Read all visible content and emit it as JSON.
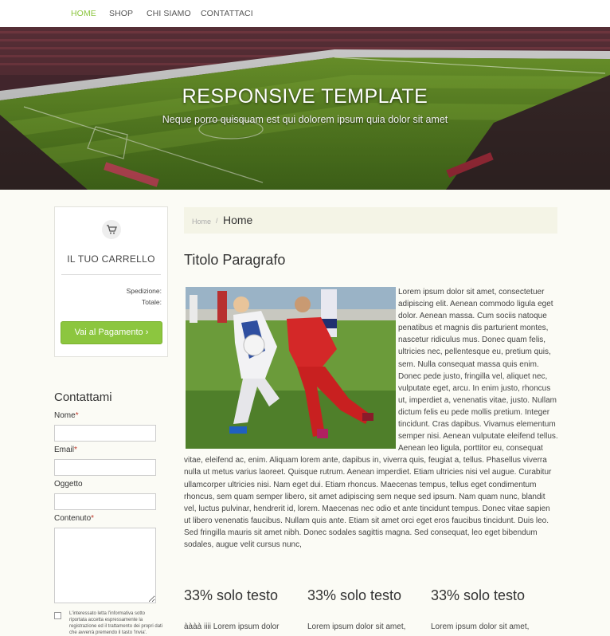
{
  "nav": {
    "items": [
      {
        "label": "HOME",
        "active": true
      },
      {
        "label": "SHOP",
        "active": false
      },
      {
        "label": "CHI SIAMO",
        "active": false
      },
      {
        "label": "CONTATTACI",
        "active": false
      }
    ]
  },
  "hero": {
    "title": "RESPONSIVE TEMPLATE",
    "subtitle": "Neque porro quisquam est qui dolorem ipsum quia dolor sit amet",
    "image": "football-stadium"
  },
  "cart": {
    "icon": "cart-icon",
    "title": "IL TUO CARRELLO",
    "shipping_label": "Spedizione:",
    "total_label": "Totale:",
    "pay_button": "Vai al Pagamento ›"
  },
  "contact": {
    "heading": "Contattami",
    "fields": {
      "name": {
        "label": "Nome",
        "required_mark": "*",
        "value": ""
      },
      "email": {
        "label": "Email",
        "required_mark": "*",
        "value": ""
      },
      "subject": {
        "label": "Oggetto",
        "value": ""
      },
      "content": {
        "label": "Contenuto",
        "required_mark": "*",
        "value": ""
      }
    },
    "privacy_text": "L'interessato letta l'informativa sotto riportata accetta espressamente la registrazione ed il trattamento dei propri dati che avverrà premendo il tasto 'Invia'."
  },
  "breadcrumb": {
    "home": "Home",
    "separator": "/",
    "current": "Home"
  },
  "main": {
    "title": "Titolo Paragrafo",
    "image": "football-players-photo",
    "body": "Lorem ipsum dolor sit amet, consectetuer adipiscing elit. Aenean commodo ligula eget dolor. Aenean massa. Cum sociis natoque penatibus et magnis dis parturient montes, nascetur ridiculus mus. Donec quam felis, ultricies nec, pellentesque eu, pretium quis, sem. Nulla consequat massa quis enim. Donec pede justo, fringilla vel, aliquet nec, vulputate eget, arcu. In enim justo, rhoncus ut, imperdiet a, venenatis vitae, justo. Nullam dictum felis eu pede mollis pretium. Integer tincidunt. Cras dapibus. Vivamus elementum semper nisi. Aenean vulputate eleifend tellus. Aenean leo ligula, porttitor eu, consequat vitae, eleifend ac, enim. Aliquam lorem ante, dapibus in, viverra quis, feugiat a, tellus. Phasellus viverra nulla ut metus varius laoreet. Quisque rutrum. Aenean imperdiet. Etiam ultricies nisi vel augue. Curabitur ullamcorper ultricies nisi. Nam eget dui. Etiam rhoncus. Maecenas tempus, tellus eget condimentum rhoncus, sem quam semper libero, sit amet adipiscing sem neque sed ipsum. Nam quam nunc, blandit vel, luctus pulvinar, hendrerit id, lorem. Maecenas nec odio et ante tincidunt tempus. Donec vitae sapien ut libero venenatis faucibus. Nullam quis ante. Etiam sit amet orci eget eros faucibus tincidunt. Duis leo. Sed fringilla mauris sit amet nibh. Donec sodales sagittis magna. Sed consequat, leo eget bibendum sodales, augue velit cursus nunc,"
  },
  "columns": [
    {
      "heading": "33% solo testo",
      "text": "àààà iiii Lorem ipsum dolor"
    },
    {
      "heading": "33% solo testo",
      "text": "Lorem ipsum dolor sit amet,"
    },
    {
      "heading": "33% solo testo",
      "text": "Lorem ipsum dolor sit amet,"
    }
  ],
  "colors": {
    "accent": "#8cc63f",
    "background": "#fbfbf5",
    "breadcrumb_bg": "#f4f4e6"
  }
}
